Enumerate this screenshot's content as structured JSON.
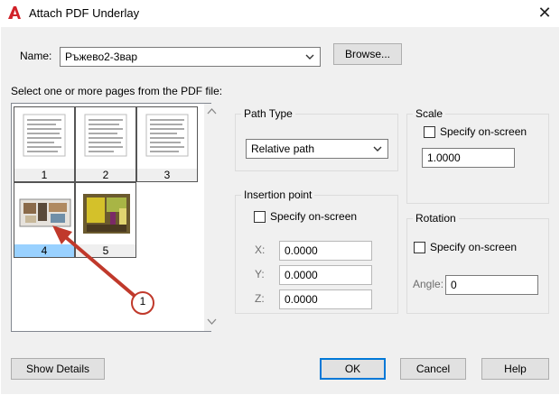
{
  "window": {
    "title": "Attach PDF Underlay",
    "close_glyph": "✕"
  },
  "name_field": {
    "label": "Name:",
    "value": "Ръжево2-3вар"
  },
  "browse_button": {
    "label": "Browse..."
  },
  "pages_prompt": "Select one or more pages from the PDF file:",
  "pages": [
    {
      "number": "1",
      "kind": "document",
      "selected": false
    },
    {
      "number": "2",
      "kind": "document",
      "selected": false
    },
    {
      "number": "3",
      "kind": "document",
      "selected": false
    },
    {
      "number": "4",
      "kind": "floorplan",
      "selected": true
    },
    {
      "number": "5",
      "kind": "room-render",
      "selected": false
    }
  ],
  "annotation": {
    "label": "1",
    "color": "#c0392b"
  },
  "path_type": {
    "title": "Path Type",
    "value": "Relative path"
  },
  "insertion_point": {
    "title": "Insertion point",
    "specify_label": "Specify on-screen",
    "x_label": "X:",
    "x_value": "0.0000",
    "y_label": "Y:",
    "y_value": "0.0000",
    "z_label": "Z:",
    "z_value": "0.0000"
  },
  "scale": {
    "title": "Scale",
    "specify_label": "Specify on-screen",
    "value": "1.0000"
  },
  "rotation": {
    "title": "Rotation",
    "specify_label": "Specify on-screen",
    "angle_label": "Angle:",
    "angle_value": "0"
  },
  "buttons": {
    "show_details": "Show Details",
    "ok": "OK",
    "cancel": "Cancel",
    "help": "Help"
  },
  "colors": {
    "accent": "#0078d7",
    "selection": "#99d1ff",
    "app_red": "#d1232a"
  }
}
